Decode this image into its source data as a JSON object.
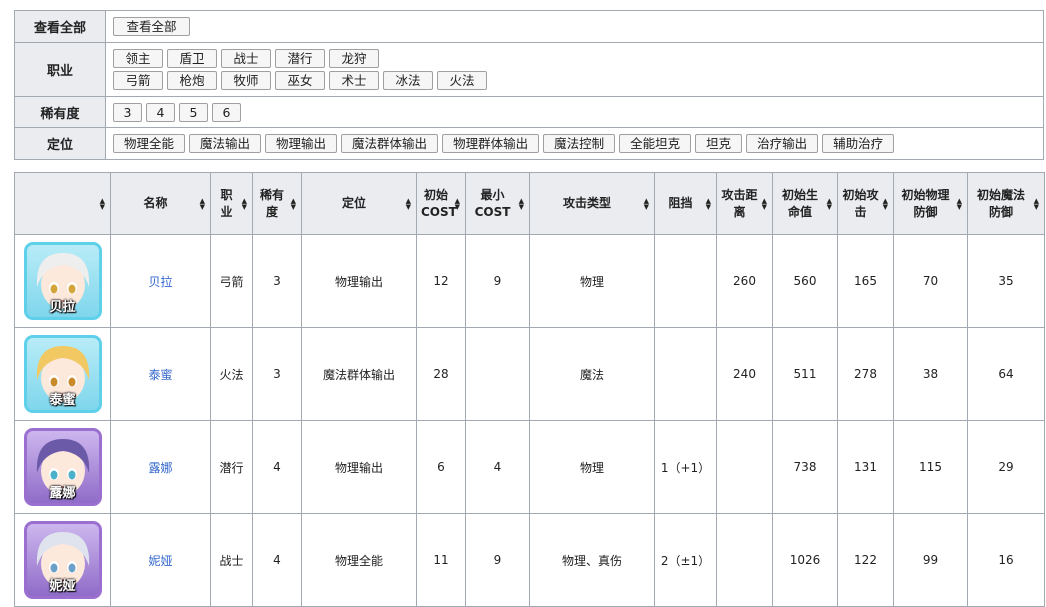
{
  "filters": [
    {
      "label": "查看全部",
      "rows": [
        [
          "查看全部"
        ]
      ]
    },
    {
      "label": "职业",
      "rows": [
        [
          "领主",
          "盾卫",
          "战士",
          "潜行",
          "龙狩"
        ],
        [
          "弓箭",
          "枪炮",
          "牧师",
          "巫女",
          "术士",
          "冰法",
          "火法"
        ]
      ]
    },
    {
      "label": "稀有度",
      "rows": [
        [
          "3",
          "4",
          "5",
          "6"
        ]
      ]
    },
    {
      "label": "定位",
      "rows": [
        [
          "物理全能",
          "魔法输出",
          "物理输出",
          "魔法群体输出",
          "物理群体输出",
          "魔法控制",
          "全能坦克",
          "坦克",
          "治疗输出",
          "辅助治疗"
        ]
      ]
    }
  ],
  "table": {
    "headers": [
      "",
      "名称",
      "职业",
      "稀有度",
      "定位",
      "初始 COST",
      "最小 COST",
      "攻击类型",
      "阻挡",
      "攻击距离",
      "初始生命值",
      "初始攻击",
      "初始物理防御",
      "初始魔法防御"
    ],
    "rows": [
      {
        "avatar": "贝拉",
        "avatar_frame": "#5fd0ea",
        "name": "贝拉",
        "job": "弓箭",
        "rarity": "3",
        "role": "物理输出",
        "cost": "12",
        "min_cost": "9",
        "attack_type": "物理",
        "block": "",
        "range": "260",
        "hp": "560",
        "atk": "165",
        "pdef": "70",
        "mdef": "35"
      },
      {
        "avatar": "泰蜜",
        "avatar_frame": "#5fd0ea",
        "name": "泰蜜",
        "job": "火法",
        "rarity": "3",
        "role": "魔法群体输出",
        "cost": "28",
        "min_cost": "",
        "attack_type": "魔法",
        "block": "",
        "range": "240",
        "hp": "511",
        "atk": "278",
        "pdef": "38",
        "mdef": "64"
      },
      {
        "avatar": "露娜",
        "avatar_frame": "#9a6fd0",
        "name": "露娜",
        "job": "潜行",
        "rarity": "4",
        "role": "物理输出",
        "cost": "6",
        "min_cost": "4",
        "attack_type": "物理",
        "block": "1（+1）",
        "range": "",
        "hp": "738",
        "atk": "131",
        "pdef": "115",
        "mdef": "29"
      },
      {
        "avatar": "妮娅",
        "avatar_frame": "#9a6fd0",
        "name": "妮娅",
        "job": "战士",
        "rarity": "4",
        "role": "物理全能",
        "cost": "11",
        "min_cost": "9",
        "attack_type": "物理、真伤",
        "block": "2（±1）",
        "range": "",
        "hp": "1026",
        "atk": "122",
        "pdef": "99",
        "mdef": "16"
      }
    ]
  },
  "sort_icon": "sort-arrows-icon"
}
